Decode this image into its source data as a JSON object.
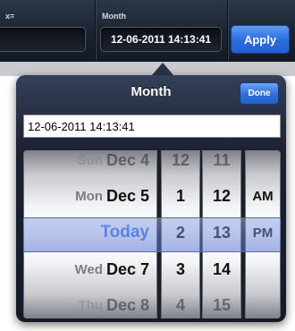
{
  "toolbar": {
    "left_label": "x=",
    "month_label": "Month",
    "month_value": "12-06-2011 14:13:41",
    "apply_label": "Apply"
  },
  "popover": {
    "title": "Month",
    "done_label": "Done",
    "input_value": "12-06-2011 14:13:41"
  },
  "picker": {
    "dates": [
      {
        "weekday": "Sun",
        "date": "Dec 4"
      },
      {
        "weekday": "Mon",
        "date": "Dec 5"
      },
      {
        "weekday": "",
        "date": "Today"
      },
      {
        "weekday": "Wed",
        "date": "Dec 7"
      },
      {
        "weekday": "Thu",
        "date": "Dec 8"
      }
    ],
    "hours": [
      "12",
      "1",
      "2",
      "3",
      "4"
    ],
    "minutes": [
      "11",
      "12",
      "13",
      "14",
      "15"
    ],
    "meridiem": [
      "",
      "AM",
      "PM",
      "",
      ""
    ]
  },
  "colors": {
    "accent": "#2d6fe0",
    "today": "#3b7ce6",
    "toolbar_bg": "#1b2330"
  }
}
